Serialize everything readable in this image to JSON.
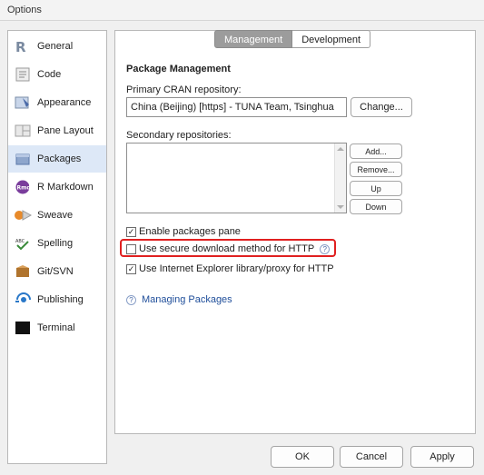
{
  "window": {
    "title": "Options"
  },
  "sidebar": {
    "items": [
      {
        "label": "General",
        "icon": "r-logo-icon"
      },
      {
        "label": "Code",
        "icon": "code-icon"
      },
      {
        "label": "Appearance",
        "icon": "appearance-icon"
      },
      {
        "label": "Pane Layout",
        "icon": "pane-layout-icon"
      },
      {
        "label": "Packages",
        "icon": "packages-icon",
        "active": true
      },
      {
        "label": "R Markdown",
        "icon": "rmd-icon"
      },
      {
        "label": "Sweave",
        "icon": "sweave-icon"
      },
      {
        "label": "Spelling",
        "icon": "spelling-icon"
      },
      {
        "label": "Git/SVN",
        "icon": "git-icon"
      },
      {
        "label": "Publishing",
        "icon": "publishing-icon"
      },
      {
        "label": "Terminal",
        "icon": "terminal-icon"
      }
    ]
  },
  "tabs": {
    "management": "Management",
    "development": "Development"
  },
  "packages": {
    "section_title": "Package Management",
    "primary_label": "Primary CRAN repository:",
    "primary_value": "China (Beijing) [https] - TUNA Team, Tsinghua",
    "change_button": "Change...",
    "secondary_label": "Secondary repositories:",
    "add_button": "Add...",
    "remove_button": "Remove...",
    "up_button": "Up",
    "down_button": "Down",
    "enable_pane_label": "Enable packages pane",
    "enable_pane_checked": true,
    "secure_download_label": "Use secure download method for HTTP",
    "secure_download_checked": false,
    "ie_proxy_label": "Use Internet Explorer library/proxy for HTTP",
    "ie_proxy_checked": true,
    "help_link": "Managing Packages"
  },
  "footer": {
    "ok": "OK",
    "cancel": "Cancel",
    "apply": "Apply"
  },
  "colors": {
    "accent": "#1f4e9a",
    "highlight": "#e02020",
    "active_tab": "#9c9c9c"
  }
}
